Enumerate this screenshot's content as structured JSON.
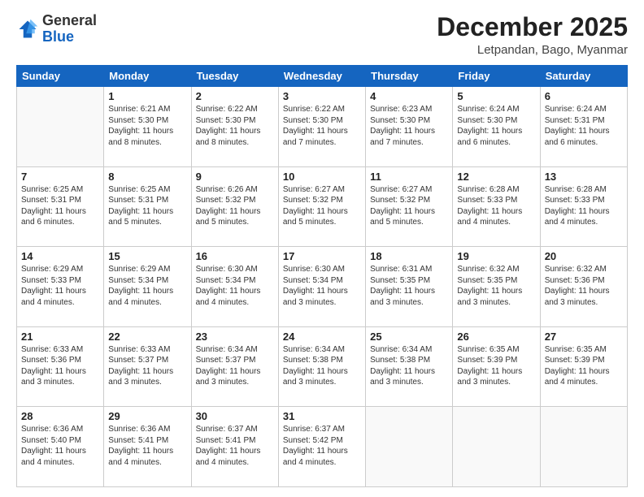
{
  "logo": {
    "general": "General",
    "blue": "Blue"
  },
  "header": {
    "month": "December 2025",
    "location": "Letpandan, Bago, Myanmar"
  },
  "weekdays": [
    "Sunday",
    "Monday",
    "Tuesday",
    "Wednesday",
    "Thursday",
    "Friday",
    "Saturday"
  ],
  "weeks": [
    [
      {
        "day": "",
        "info": ""
      },
      {
        "day": "1",
        "info": "Sunrise: 6:21 AM\nSunset: 5:30 PM\nDaylight: 11 hours\nand 8 minutes."
      },
      {
        "day": "2",
        "info": "Sunrise: 6:22 AM\nSunset: 5:30 PM\nDaylight: 11 hours\nand 8 minutes."
      },
      {
        "day": "3",
        "info": "Sunrise: 6:22 AM\nSunset: 5:30 PM\nDaylight: 11 hours\nand 7 minutes."
      },
      {
        "day": "4",
        "info": "Sunrise: 6:23 AM\nSunset: 5:30 PM\nDaylight: 11 hours\nand 7 minutes."
      },
      {
        "day": "5",
        "info": "Sunrise: 6:24 AM\nSunset: 5:30 PM\nDaylight: 11 hours\nand 6 minutes."
      },
      {
        "day": "6",
        "info": "Sunrise: 6:24 AM\nSunset: 5:31 PM\nDaylight: 11 hours\nand 6 minutes."
      }
    ],
    [
      {
        "day": "7",
        "info": "Sunrise: 6:25 AM\nSunset: 5:31 PM\nDaylight: 11 hours\nand 6 minutes."
      },
      {
        "day": "8",
        "info": "Sunrise: 6:25 AM\nSunset: 5:31 PM\nDaylight: 11 hours\nand 5 minutes."
      },
      {
        "day": "9",
        "info": "Sunrise: 6:26 AM\nSunset: 5:32 PM\nDaylight: 11 hours\nand 5 minutes."
      },
      {
        "day": "10",
        "info": "Sunrise: 6:27 AM\nSunset: 5:32 PM\nDaylight: 11 hours\nand 5 minutes."
      },
      {
        "day": "11",
        "info": "Sunrise: 6:27 AM\nSunset: 5:32 PM\nDaylight: 11 hours\nand 5 minutes."
      },
      {
        "day": "12",
        "info": "Sunrise: 6:28 AM\nSunset: 5:33 PM\nDaylight: 11 hours\nand 4 minutes."
      },
      {
        "day": "13",
        "info": "Sunrise: 6:28 AM\nSunset: 5:33 PM\nDaylight: 11 hours\nand 4 minutes."
      }
    ],
    [
      {
        "day": "14",
        "info": "Sunrise: 6:29 AM\nSunset: 5:33 PM\nDaylight: 11 hours\nand 4 minutes."
      },
      {
        "day": "15",
        "info": "Sunrise: 6:29 AM\nSunset: 5:34 PM\nDaylight: 11 hours\nand 4 minutes."
      },
      {
        "day": "16",
        "info": "Sunrise: 6:30 AM\nSunset: 5:34 PM\nDaylight: 11 hours\nand 4 minutes."
      },
      {
        "day": "17",
        "info": "Sunrise: 6:30 AM\nSunset: 5:34 PM\nDaylight: 11 hours\nand 3 minutes."
      },
      {
        "day": "18",
        "info": "Sunrise: 6:31 AM\nSunset: 5:35 PM\nDaylight: 11 hours\nand 3 minutes."
      },
      {
        "day": "19",
        "info": "Sunrise: 6:32 AM\nSunset: 5:35 PM\nDaylight: 11 hours\nand 3 minutes."
      },
      {
        "day": "20",
        "info": "Sunrise: 6:32 AM\nSunset: 5:36 PM\nDaylight: 11 hours\nand 3 minutes."
      }
    ],
    [
      {
        "day": "21",
        "info": "Sunrise: 6:33 AM\nSunset: 5:36 PM\nDaylight: 11 hours\nand 3 minutes."
      },
      {
        "day": "22",
        "info": "Sunrise: 6:33 AM\nSunset: 5:37 PM\nDaylight: 11 hours\nand 3 minutes."
      },
      {
        "day": "23",
        "info": "Sunrise: 6:34 AM\nSunset: 5:37 PM\nDaylight: 11 hours\nand 3 minutes."
      },
      {
        "day": "24",
        "info": "Sunrise: 6:34 AM\nSunset: 5:38 PM\nDaylight: 11 hours\nand 3 minutes."
      },
      {
        "day": "25",
        "info": "Sunrise: 6:34 AM\nSunset: 5:38 PM\nDaylight: 11 hours\nand 3 minutes."
      },
      {
        "day": "26",
        "info": "Sunrise: 6:35 AM\nSunset: 5:39 PM\nDaylight: 11 hours\nand 3 minutes."
      },
      {
        "day": "27",
        "info": "Sunrise: 6:35 AM\nSunset: 5:39 PM\nDaylight: 11 hours\nand 4 minutes."
      }
    ],
    [
      {
        "day": "28",
        "info": "Sunrise: 6:36 AM\nSunset: 5:40 PM\nDaylight: 11 hours\nand 4 minutes."
      },
      {
        "day": "29",
        "info": "Sunrise: 6:36 AM\nSunset: 5:41 PM\nDaylight: 11 hours\nand 4 minutes."
      },
      {
        "day": "30",
        "info": "Sunrise: 6:37 AM\nSunset: 5:41 PM\nDaylight: 11 hours\nand 4 minutes."
      },
      {
        "day": "31",
        "info": "Sunrise: 6:37 AM\nSunset: 5:42 PM\nDaylight: 11 hours\nand 4 minutes."
      },
      {
        "day": "",
        "info": ""
      },
      {
        "day": "",
        "info": ""
      },
      {
        "day": "",
        "info": ""
      }
    ]
  ]
}
